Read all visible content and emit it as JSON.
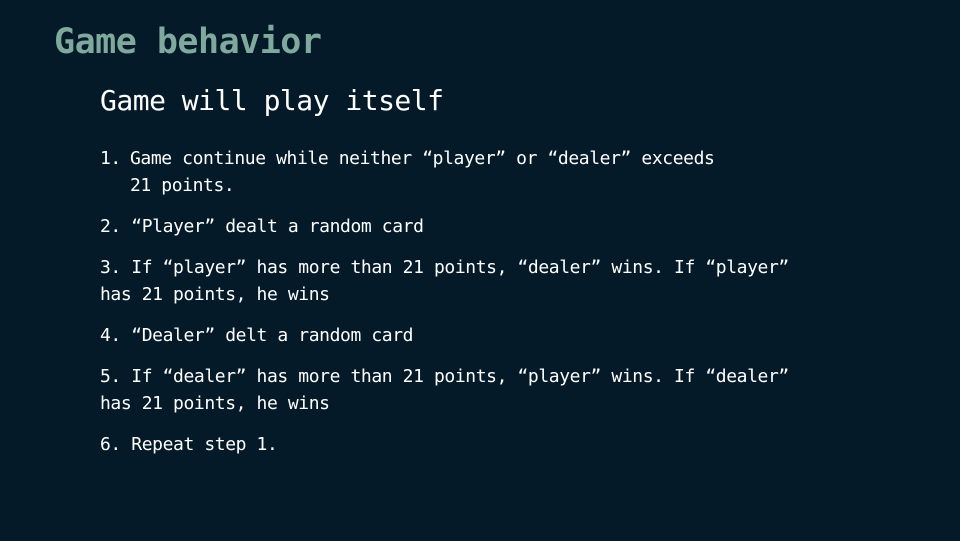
{
  "title": "Game behavior",
  "subtitle": "Game will play itself",
  "steps": [
    {
      "num": "1.",
      "line1": "Game continue while neither “player” or “dealer” exceeds",
      "line2": "21 points."
    },
    {
      "text": "2. “Player” dealt a random card"
    },
    {
      "line1": "3. If “player” has more than 21 points, “dealer” wins. If “player”",
      "line2": "has 21 points, he wins"
    },
    {
      "text": "4. “Dealer” delt a random card"
    },
    {
      "line1": "5. If “dealer” has more than 21 points, “player” wins. If “dealer”",
      "line2": "has 21 points, he wins"
    },
    {
      "text": "6. Repeat step 1."
    }
  ]
}
